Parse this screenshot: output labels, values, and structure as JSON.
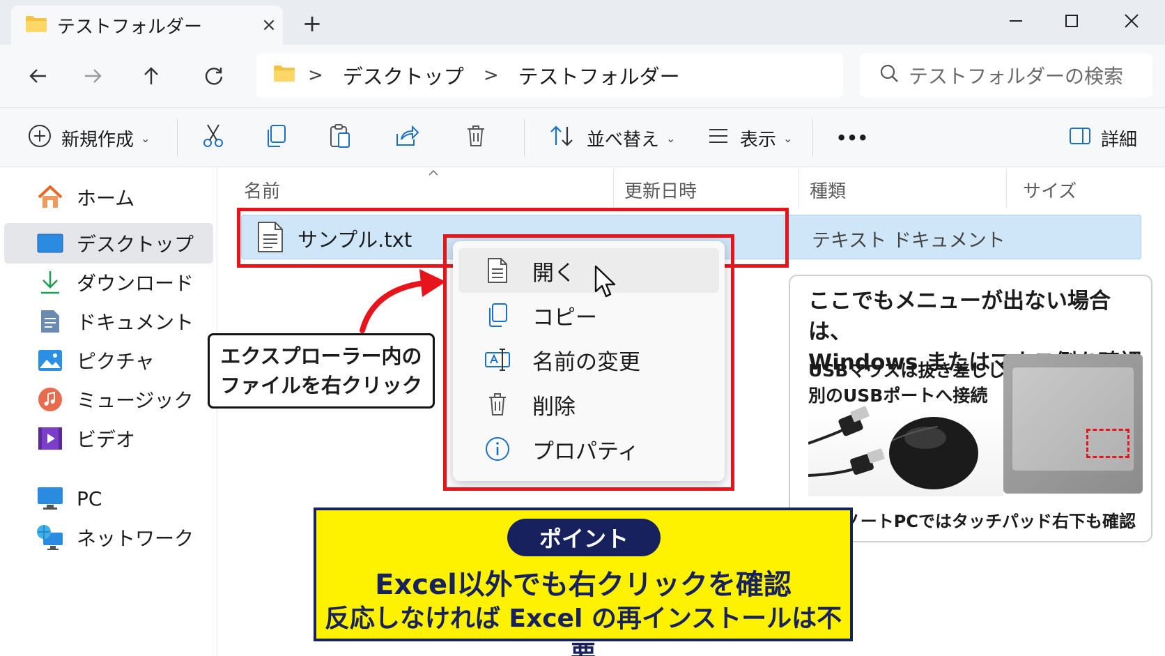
{
  "window": {
    "tab_title": "テストフォルダー",
    "tab_close": "×",
    "new_tab": "+"
  },
  "address_bar": {
    "crumbs": [
      "デスクトップ",
      "テストフォルダー"
    ],
    "separator": ">",
    "search_placeholder": "テストフォルダーの検索"
  },
  "toolbar": {
    "new_label": "新規作成",
    "sort_label": "並べ替え",
    "view_label": "表示",
    "more_label": "•••",
    "details_label": "詳細"
  },
  "sidebar": {
    "items": [
      {
        "label": "ホーム",
        "icon": "home-icon"
      },
      {
        "label": "デスクトップ",
        "icon": "desktop-icon",
        "selected": true
      },
      {
        "label": "ダウンロード",
        "icon": "download-icon"
      },
      {
        "label": "ドキュメント",
        "icon": "document-icon"
      },
      {
        "label": "ピクチャ",
        "icon": "pictures-icon"
      },
      {
        "label": "ミュージック",
        "icon": "music-icon"
      },
      {
        "label": "ビデオ",
        "icon": "video-icon"
      },
      {
        "label": "PC",
        "icon": "pc-icon"
      },
      {
        "label": "ネットワーク",
        "icon": "network-icon"
      }
    ]
  },
  "columns": [
    "名前",
    "更新日時",
    "種類",
    "サイズ"
  ],
  "file": {
    "name": "サンプル.txt",
    "type": "テキスト ドキュメント"
  },
  "context_menu": {
    "items": [
      {
        "label": "開く",
        "icon": "document-icon"
      },
      {
        "label": "コピー",
        "icon": "copy-icon"
      },
      {
        "label": "名前の変更",
        "icon": "rename-icon"
      },
      {
        "label": "削除",
        "icon": "trash-icon"
      },
      {
        "label": "プロパティ",
        "icon": "info-icon"
      }
    ]
  },
  "callout": {
    "line1": "エクスプローラー内の",
    "line2": "ファイルを右クリック"
  },
  "info_panel": {
    "title_line1": "ここでもメニューが出ない場合は、",
    "title_line2": "Windows またはマウス側を確認",
    "sub_line1": "USBマウスは抜き差しし、",
    "sub_line2": "別のUSBポートへ接続",
    "caption": "ノートPCではタッチパッド右下も確認"
  },
  "point": {
    "badge": "ポイント",
    "line1": "Excel以外でも右クリックを確認",
    "line2": "反応しなければ Excel の再インストールは不要"
  },
  "colors": {
    "highlight_red": "#e8141c",
    "selection_blue": "#cfe6f8",
    "point_yellow": "#fff200",
    "point_navy": "#16215e",
    "folder_yellow": "#f5c242",
    "accent_blue": "#1a6fc9"
  }
}
